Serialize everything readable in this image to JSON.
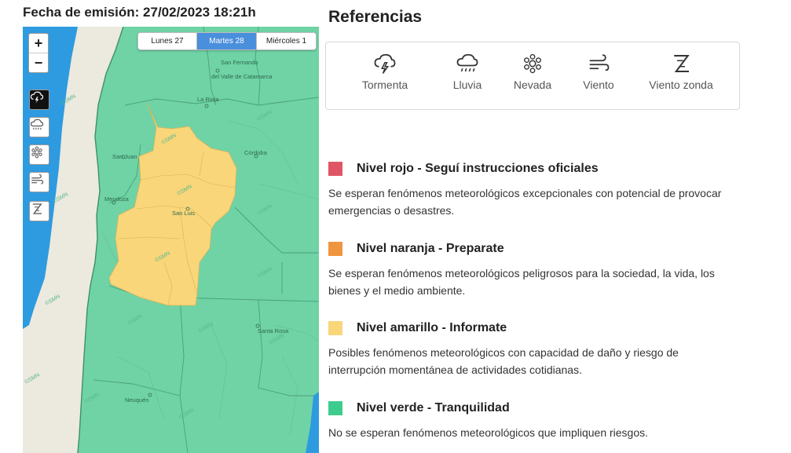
{
  "issue_date": "Fecha de emisión: 27/02/2023 18:21h",
  "map": {
    "days": [
      {
        "label": "Lunes 27",
        "active": false
      },
      {
        "label": "Martes 28",
        "active": true
      },
      {
        "label": "Miércoles 1",
        "active": false
      }
    ],
    "zoom_in": "+",
    "zoom_out": "−",
    "layers": [
      {
        "name": "tormenta-layer-button",
        "icon": "storm-icon",
        "active": true
      },
      {
        "name": "lluvia-layer-button",
        "icon": "rain-icon",
        "active": false
      },
      {
        "name": "nevada-layer-button",
        "icon": "snow-icon",
        "active": false
      },
      {
        "name": "viento-layer-button",
        "icon": "wind-icon",
        "active": false
      },
      {
        "name": "viento-zonda-layer-button",
        "icon": "zonda-icon",
        "active": false
      }
    ],
    "cities": {
      "san_fernando": "San Fernando",
      "del_valle": "del Valle de Catamarca",
      "la_rioja": "La Rioja",
      "san_juan": "San Juan",
      "cordoba": "Córdoba",
      "mendoza": "Mendoza",
      "san_luis": "San Luis",
      "santa_rosa": "Santa Rosa",
      "neuquen": "Neuquén"
    },
    "watermark": "©SMN",
    "colors": {
      "ocean": "#2e9ae0",
      "chile": "#ece9df",
      "green": "#6fd3a5",
      "yellow": "#f9d67a"
    }
  },
  "references": {
    "title": "Referencias",
    "items": [
      {
        "label": "Tormenta",
        "icon": "storm-icon"
      },
      {
        "label": "Lluvia",
        "icon": "rain-icon"
      },
      {
        "label": "Nevada",
        "icon": "snow-icon"
      },
      {
        "label": "Viento",
        "icon": "wind-icon"
      },
      {
        "label": "Viento zonda",
        "icon": "zonda-icon"
      }
    ]
  },
  "levels": [
    {
      "color": "#e05566",
      "title": "Nivel rojo - Seguí instrucciones oficiales",
      "desc": "Se esperan fenómenos meteorológicos excepcionales con potencial de provocar emergencias o desastres."
    },
    {
      "color": "#f0953f",
      "title": "Nivel naranja - Preparate",
      "desc": "Se esperan fenómenos meteorológicos peligrosos para la sociedad, la vida, los bienes y el medio ambiente."
    },
    {
      "color": "#f9d67a",
      "title": "Nivel amarillo - Informate",
      "desc": "Posibles fenómenos meteorológicos con capacidad de daño y riesgo de interrupción momentánea de actividades cotidianas."
    },
    {
      "color": "#3ecc8e",
      "title": "Nivel verde - Tranquilidad",
      "desc": "No se esperan fenómenos meteorológicos que impliquen riesgos."
    }
  ]
}
